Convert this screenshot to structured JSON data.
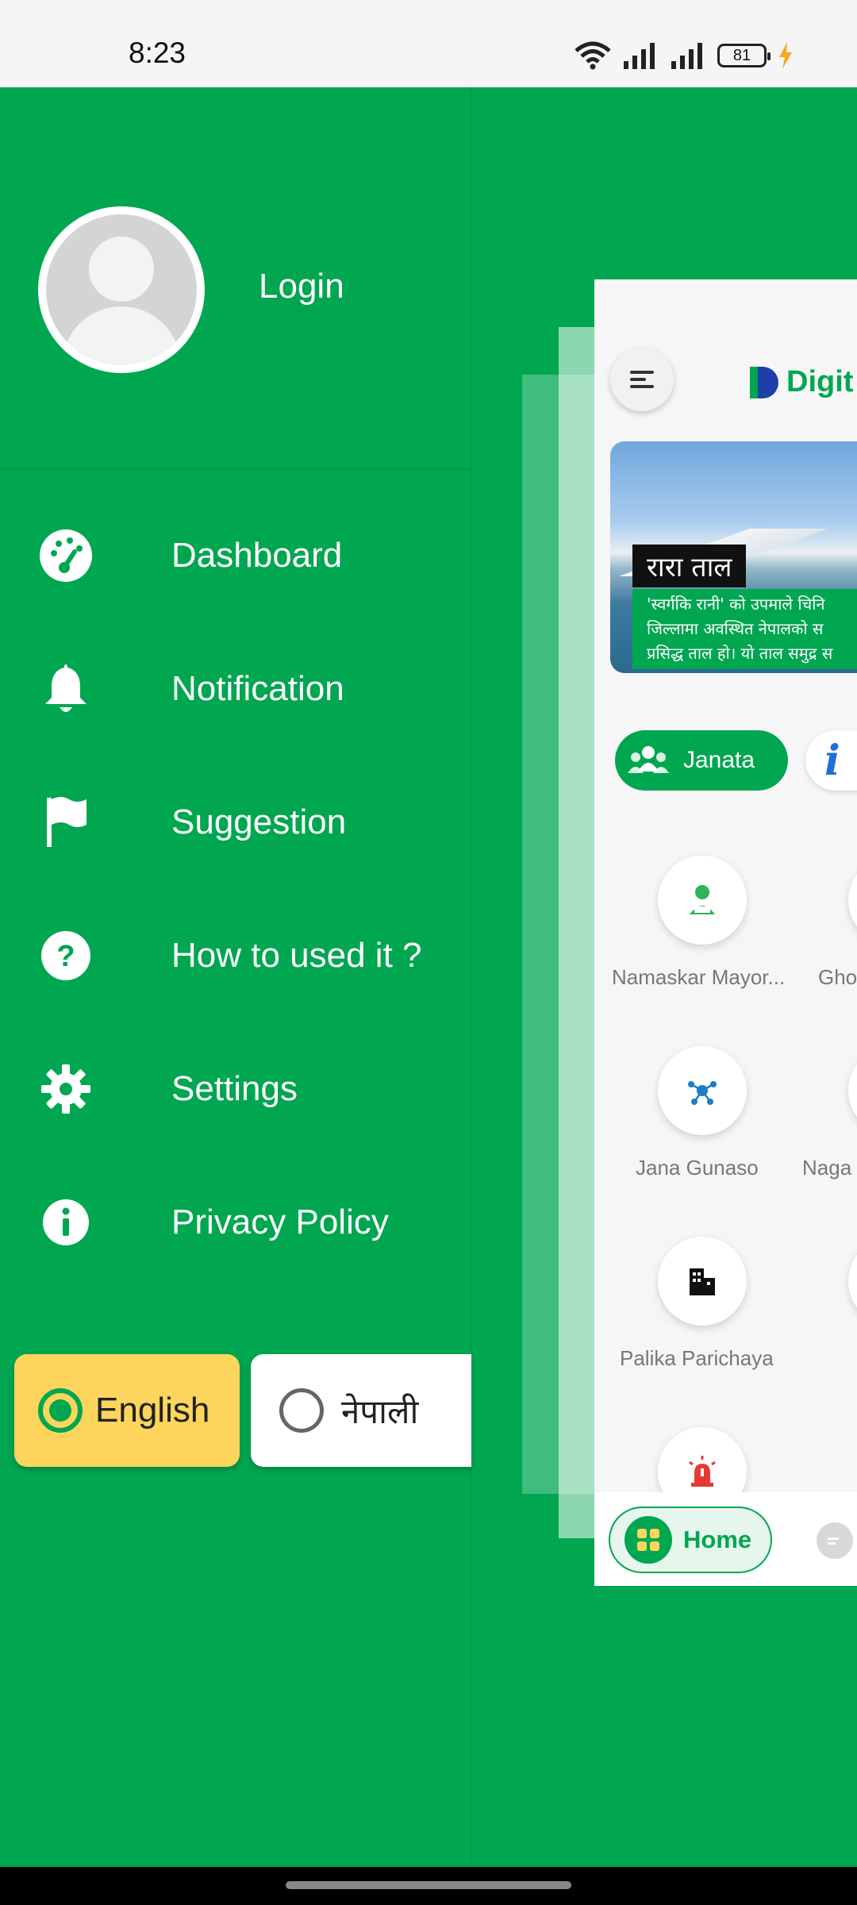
{
  "status_bar": {
    "time": "8:23",
    "battery": "81",
    "icons": [
      "wifi-icon",
      "signal-icon",
      "signal-icon",
      "battery-icon",
      "charging-icon"
    ]
  },
  "drawer": {
    "login_label": "Login",
    "menu": [
      {
        "label": "Dashboard",
        "icon": "dashboard-icon"
      },
      {
        "label": "Notification",
        "icon": "bell-icon"
      },
      {
        "label": "Suggestion",
        "icon": "flag-icon"
      },
      {
        "label": "How to used it ?",
        "icon": "help-icon"
      },
      {
        "label": "Settings",
        "icon": "gear-icon"
      },
      {
        "label": "Privacy Policy",
        "icon": "info-icon"
      }
    ],
    "languages": {
      "english": "English",
      "nepali": "नेपाली",
      "selected": "English"
    }
  },
  "app_preview": {
    "logo_text": "Digit",
    "banner": {
      "title": "रारा ताल",
      "lines": [
        "'स्वर्गकि रानी' को उपमाले चिनि",
        "जिल्लामा अवस्थित नेपालको स",
        "प्रसिद्ध ताल हो। यो ताल समुद्र स"
      ]
    },
    "chips": {
      "janata": "Janata",
      "info_symbol": "i"
    },
    "services": [
      {
        "label": "Namaskar Mayor..."
      },
      {
        "label": "Gho"
      },
      {
        "label": "Jana Gunaso"
      },
      {
        "label": "Naga"
      },
      {
        "label": "Palika Parichaya"
      }
    ],
    "bottom_nav": {
      "home_label": "Home"
    }
  },
  "colors": {
    "primary_green": "#00a650",
    "english_selected_bg": "#fdd55c",
    "accent_blue": "#1e6fd9"
  }
}
